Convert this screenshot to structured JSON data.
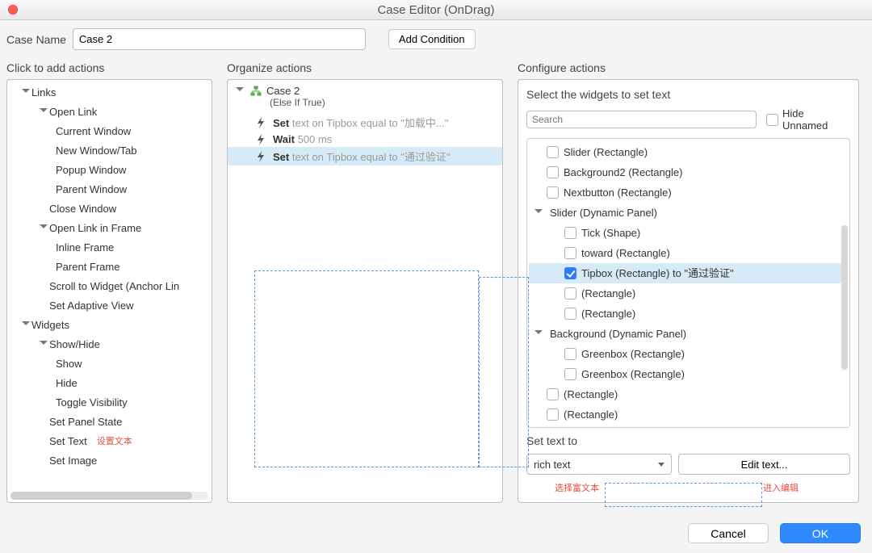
{
  "window": {
    "title": "Case Editor (OnDrag)"
  },
  "form": {
    "case_name_label": "Case Name",
    "case_name_value": "Case 2",
    "add_condition": "Add Condition"
  },
  "columns": {
    "c1": "Click to add actions",
    "c2": "Organize actions",
    "c3": "Configure actions"
  },
  "actions_tree": {
    "links": "Links",
    "open_link": "Open Link",
    "current_window": "Current Window",
    "new_window": "New Window/Tab",
    "popup_window": "Popup Window",
    "parent_window": "Parent Window",
    "close_window": "Close Window",
    "open_link_frame": "Open Link in Frame",
    "inline_frame": "Inline Frame",
    "parent_frame": "Parent Frame",
    "scroll_to_widget": "Scroll to Widget (Anchor Lin",
    "set_adaptive": "Set Adaptive View",
    "widgets": "Widgets",
    "show_hide": "Show/Hide",
    "show": "Show",
    "hide": "Hide",
    "toggle": "Toggle Visibility",
    "set_panel_state": "Set Panel State",
    "set_text": "Set Text",
    "set_text_ann": "设置文本",
    "set_image": "Set Image"
  },
  "case": {
    "name_label": "Case 2",
    "sub": "(Else If True)",
    "act1_a": "Set ",
    "act1_b": "text on Tipbox equal to \"加载中...\"",
    "act2_a": "Wait ",
    "act2_b": "500 ms",
    "act3_a": "Set ",
    "act3_b": "text on Tipbox equal to \"通过验证\""
  },
  "configure": {
    "select_header": "Select the widgets to set text",
    "search_ph": "Search",
    "hide_unnamed": "Hide Unnamed",
    "widgets": {
      "slider_rect": "Slider (Rectangle)",
      "bg2": "Background2 (Rectangle)",
      "nextbtn": "Nextbutton (Rectangle)",
      "slider_dp": "Slider (Dynamic Panel)",
      "tick": "Tick (Shape)",
      "toward": "toward (Rectangle)",
      "tipbox": "Tipbox (Rectangle) to \"通过验证\"",
      "rect1": "(Rectangle)",
      "rect2": "(Rectangle)",
      "bg_dp": "Background (Dynamic Panel)",
      "green1": "Greenbox (Rectangle)",
      "green2": "Greenbox (Rectangle)",
      "rect3": "(Rectangle)",
      "rect4": "(Rectangle)"
    },
    "set_text_to": "Set text to",
    "rich_text": "rich text",
    "edit_text": "Edit text...",
    "ann_left": "选择富文本",
    "ann_right": "进入编辑"
  },
  "footer": {
    "cancel": "Cancel",
    "ok": "OK"
  }
}
